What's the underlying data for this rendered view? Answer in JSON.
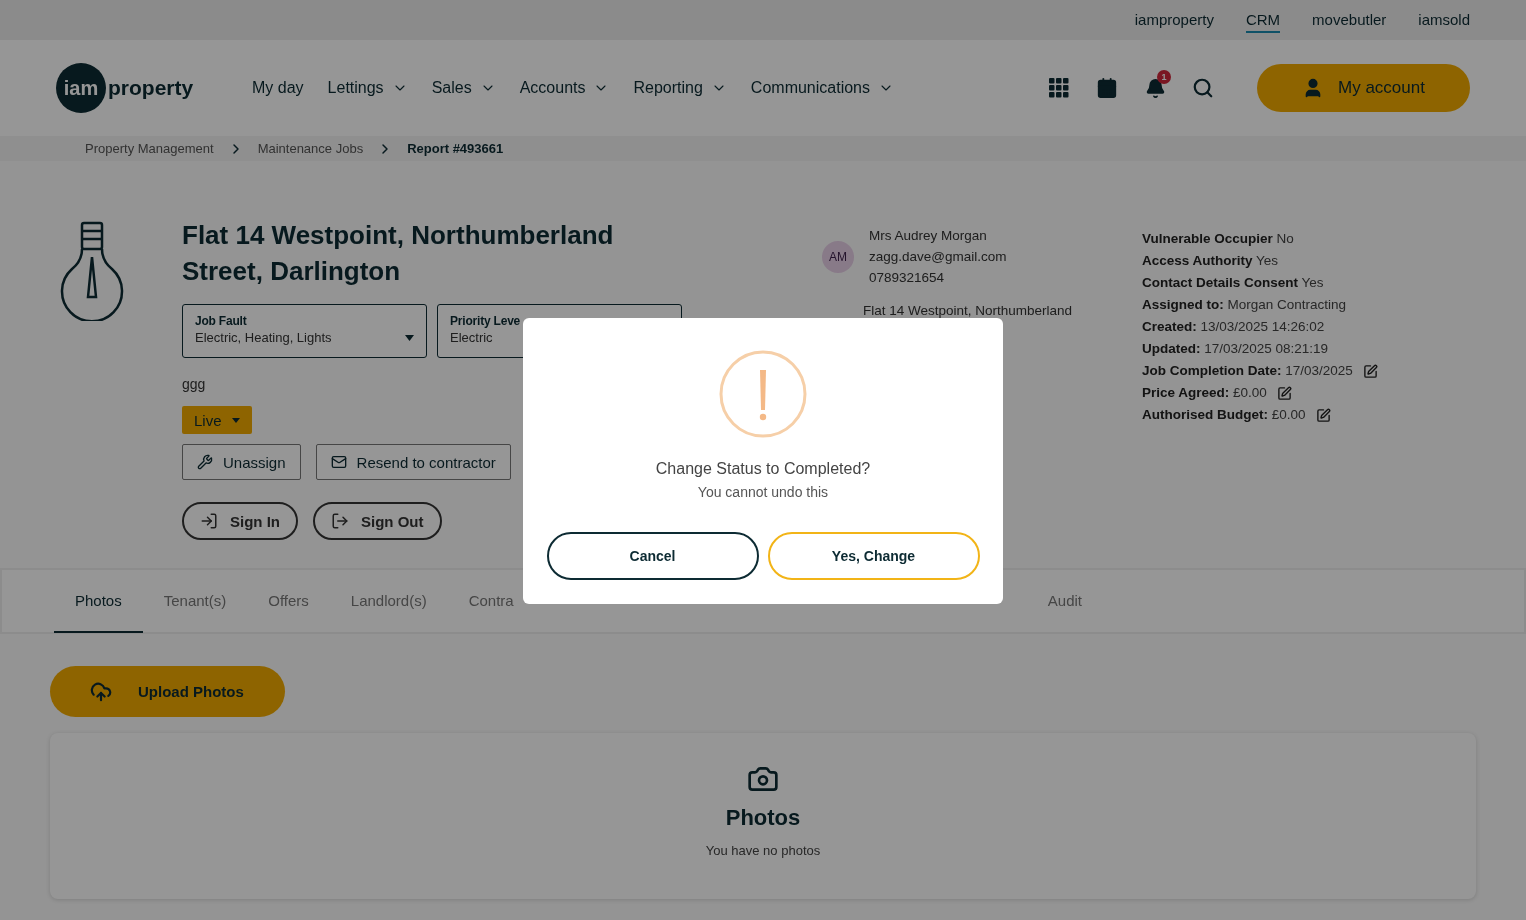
{
  "top_links": [
    {
      "label": "iamproperty",
      "selected": false
    },
    {
      "label": "CRM",
      "selected": true
    },
    {
      "label": "movebutler",
      "selected": false
    },
    {
      "label": "iamsold",
      "selected": false
    }
  ],
  "logo": {
    "mark": "iam",
    "word": "property"
  },
  "nav": [
    {
      "label": "My day",
      "dropdown": false
    },
    {
      "label": "Lettings",
      "dropdown": true
    },
    {
      "label": "Sales",
      "dropdown": true
    },
    {
      "label": "Accounts",
      "dropdown": true
    },
    {
      "label": "Reporting",
      "dropdown": true
    },
    {
      "label": "Communications",
      "dropdown": true
    }
  ],
  "notifications": {
    "count": "1"
  },
  "account_button": "My account",
  "breadcrumb": [
    {
      "label": "Property Management",
      "current": false
    },
    {
      "label": "Maintenance Jobs",
      "current": false
    },
    {
      "label": "Report #493661",
      "current": true
    }
  ],
  "job": {
    "title": "Flat 14 Westpoint, Northumberland Street, Darlington",
    "selects": [
      {
        "label": "Job Fault",
        "value": "Electric, Heating, Lights",
        "caret": true
      },
      {
        "label": "Priority Leve",
        "value": "Electric"
      }
    ],
    "description": "ggg",
    "status": "Live",
    "actions": [
      {
        "kind": "unassign",
        "label": "Unassign"
      },
      {
        "kind": "resend",
        "label": "Resend to contractor"
      }
    ],
    "sign_buttons": [
      {
        "kind": "in",
        "label": "Sign In"
      },
      {
        "kind": "out",
        "label": "Sign Out"
      }
    ]
  },
  "contact": {
    "initials": "AM",
    "name": "Mrs Audrey Morgan",
    "email": "zagg.dave@gmail.com",
    "phone": "0789321654",
    "address": "Flat 14 Westpoint, Northumberland"
  },
  "details": [
    {
      "text": "**Vulnerable Occupier** No",
      "editable": false
    },
    {
      "text": "**Access Authority** Yes",
      "editable": false
    },
    {
      "text": "**Contact Details Consent** Yes",
      "editable": false
    },
    {
      "text": "**Assigned to:** Morgan Contracting",
      "editable": false
    },
    {
      "text": "**Created:** 13/03/2025 14:26:02",
      "editable": false
    },
    {
      "text": "**Updated:** 17/03/2025 08:21:19",
      "editable": false
    },
    {
      "text": "**Job Completion Date:** 17/03/2025",
      "editable": true
    },
    {
      "text": "**Price Agreed:** £0.00",
      "editable": true
    },
    {
      "text": "**Authorised Budget:** £0.00",
      "editable": true
    }
  ],
  "tabs": [
    {
      "label": "Photos",
      "selected": true
    },
    {
      "label": "Tenant(s)",
      "selected": false
    },
    {
      "label": "Offers",
      "selected": false
    },
    {
      "label": "Landlord(s)",
      "selected": false
    },
    {
      "label": "Contra",
      "selected": false
    },
    {
      "label": "Audit",
      "selected": false
    }
  ],
  "upload_button": "Upload Photos",
  "photos": {
    "title": "Photos",
    "empty_text": "You have no photos"
  },
  "dialog": {
    "title": "Change Status to Completed?",
    "message": "You cannot undo this",
    "buttons": [
      {
        "kind": "cancel",
        "label": "Cancel"
      },
      {
        "kind": "confirm",
        "label": "Yes, Change"
      }
    ]
  }
}
